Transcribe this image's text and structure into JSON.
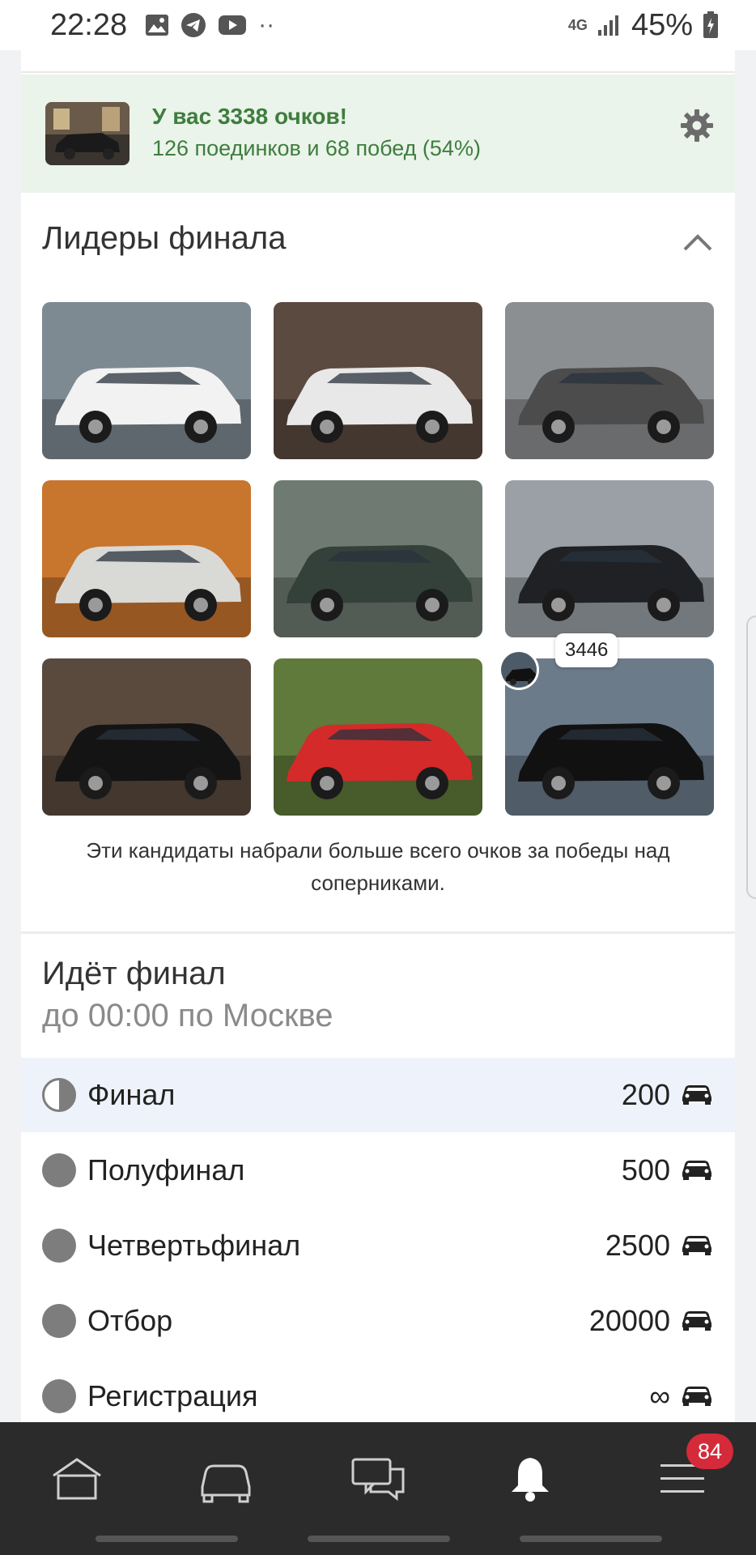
{
  "status_bar": {
    "time": "22:28",
    "network": "4G",
    "battery": "45%"
  },
  "score": {
    "title": "У вас 3338 очков!",
    "subtitle": "126 поединков и 68 побед (54%)"
  },
  "leaders": {
    "title": "Лидеры финала",
    "caption": "Эти кандидаты набрали больше всего очков за победы над соперниками.",
    "highlight_score": "3446",
    "tiles": [
      {
        "name": "white-wagon",
        "bg": "#7d8a92",
        "car": "#f2f2f2"
      },
      {
        "name": "white-sedan-rear",
        "bg": "#5b4a40",
        "car": "#e8e8e8"
      },
      {
        "name": "grey-volga",
        "bg": "#8c8f92",
        "car": "#4c4c4c"
      },
      {
        "name": "silver-bmw-autumn",
        "bg": "#c8752e",
        "car": "#d9d9d6"
      },
      {
        "name": "green-golf",
        "bg": "#6f7a72",
        "car": "#34413b"
      },
      {
        "name": "black-van",
        "bg": "#9aa0a6",
        "car": "#1f2124"
      },
      {
        "name": "black-lexus",
        "bg": "#5a4a3e",
        "car": "#141414"
      },
      {
        "name": "red-audi",
        "bg": "#5f7a3a",
        "car": "#d42a2a"
      },
      {
        "name": "black-chaser",
        "bg": "#6b7b8a",
        "car": "#111111"
      }
    ]
  },
  "final": {
    "title": "Идёт финал",
    "subtitle": "до 00:00 по Москве",
    "stages": [
      {
        "label": "Финал",
        "value": "200",
        "active": true
      },
      {
        "label": "Полуфинал",
        "value": "500",
        "active": false
      },
      {
        "label": "Четвертьфинал",
        "value": "2500",
        "active": false
      },
      {
        "label": "Отбор",
        "value": "20000",
        "active": false
      },
      {
        "label": "Регистрация",
        "value": "∞",
        "active": false
      }
    ]
  },
  "nav": {
    "notifications_badge": "84"
  },
  "colors": {
    "accent_green": "#3f7d3f",
    "score_bg": "#eaf4ea",
    "nav_bg": "#2b2b2b",
    "badge_red": "#d42a3a"
  }
}
